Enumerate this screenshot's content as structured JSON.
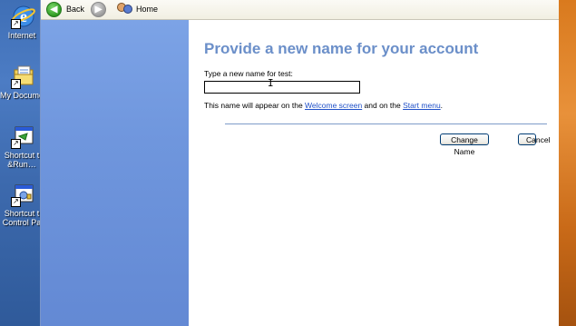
{
  "desktop": {
    "icons": [
      {
        "name": "internet-explorer",
        "label": "Internet"
      },
      {
        "name": "my-documents",
        "label": "My Docume"
      },
      {
        "name": "shortcut-run",
        "label_line1": "Shortcut t",
        "label_line2": "&Run…"
      },
      {
        "name": "shortcut-control-panel",
        "label_line1": "Shortcut t",
        "label_line2": "Control Pa"
      }
    ]
  },
  "toolbar": {
    "back_label": "Back",
    "home_label": "Home",
    "back_icon": "back-arrow-icon",
    "forward_icon": "forward-arrow-icon",
    "home_icon": "user-accounts-home-icon"
  },
  "main": {
    "title": "Provide a new name for your account",
    "prompt": "Type a new name for test:",
    "name_value": "",
    "info_prefix": "This name will appear on the ",
    "info_link1": "Welcome screen",
    "info_middle": " and on the ",
    "info_link2": "Start menu",
    "info_suffix": ".",
    "change_button": "Change Name",
    "cancel_button": "Cancel"
  },
  "colors": {
    "title": "#6b8fc9",
    "task_pane": "#7ca3e6",
    "link": "#1f50c8"
  }
}
